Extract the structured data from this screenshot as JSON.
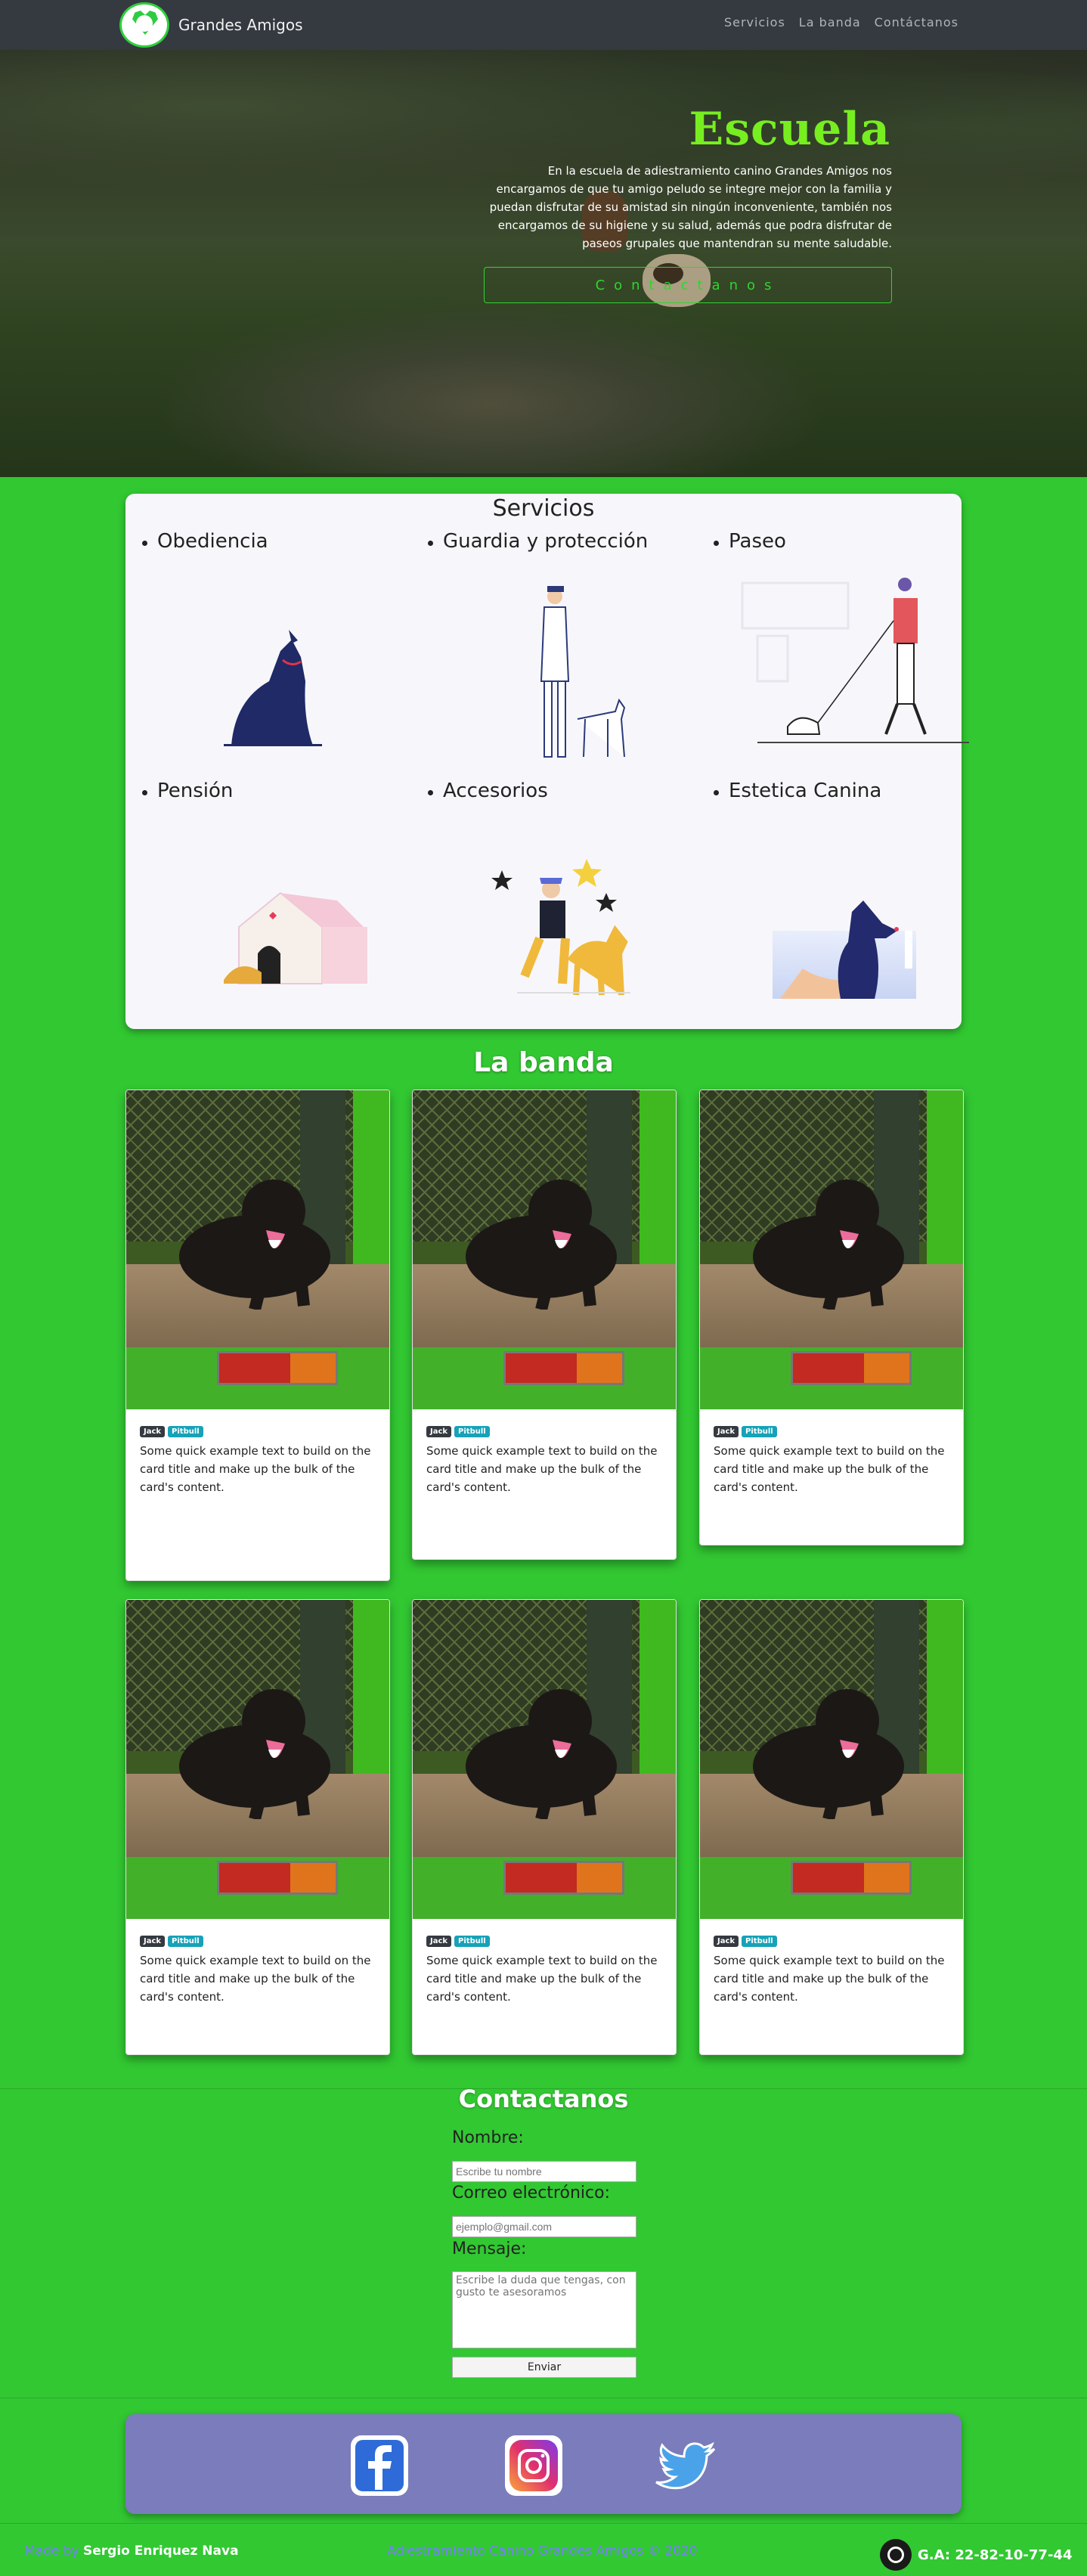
{
  "brand": {
    "name": "Grandes Amigos"
  },
  "nav": {
    "items": [
      "Servicios",
      "La banda",
      "Contáctanos"
    ]
  },
  "hero": {
    "title": "Escuela",
    "text": "En la escuela de adiestramiento canino Grandes Amigos nos encargamos de que tu amigo peludo se integre mejor con la familia y puedan disfrutar de su amistad sin ningún inconveniente, también nos encargamos de su higiene y su salud, además que podra disfrutar de paseos grupales que mantendran su mente saludable.",
    "button": "Contactanos"
  },
  "services": {
    "title": "Servicios",
    "items": [
      {
        "label": "Obediencia"
      },
      {
        "label": "Guardia y protección"
      },
      {
        "label": "Paseo"
      },
      {
        "label": "Pensión"
      },
      {
        "label": "Accesorios"
      },
      {
        "label": "Estetica Canina"
      }
    ]
  },
  "team": {
    "title": "La banda",
    "cards": [
      {
        "badge1": "Jack",
        "badge2": "Pitbull",
        "text": "Some quick example text to build on the card title and make up the bulk of the card's content."
      },
      {
        "badge1": "Jack",
        "badge2": "Pitbull",
        "text": "Some quick example text to build on the card title and make up the bulk of the card's content."
      },
      {
        "badge1": "Jack",
        "badge2": "Pitbull",
        "text": "Some quick example text to build on the card title and make up the bulk of the card's content."
      },
      {
        "badge1": "Jack",
        "badge2": "Pitbull",
        "text": "Some quick example text to build on the card title and make up the bulk of the card's content."
      },
      {
        "badge1": "Jack",
        "badge2": "Pitbull",
        "text": "Some quick example text to build on the card title and make up the bulk of the card's content."
      },
      {
        "badge1": "Jack",
        "badge2": "Pitbull",
        "text": "Some quick example text to build on the card title and make up the bulk of the card's content."
      }
    ]
  },
  "contact": {
    "title": "Contactanos",
    "name_label": "Nombre:",
    "name_placeholder": "Escribe tu nombre",
    "email_label": "Correo electrónico:",
    "email_placeholder": "ejemplo@gmail.com",
    "message_label": "Mensaje:",
    "message_placeholder": "Escribe la duda que tengas, con gusto te asesoramos",
    "submit": "Enviar"
  },
  "social": {
    "icons": [
      "facebook-icon",
      "instagram-icon",
      "twitter-icon"
    ]
  },
  "footer": {
    "made_by_prefix": "Made by",
    "author": "Sergio Enriquez Nava",
    "copyright": "Adiestramiento Canino Grandes Amigos © 2020",
    "phone": "G.A: 22-82-10-77-44"
  }
}
